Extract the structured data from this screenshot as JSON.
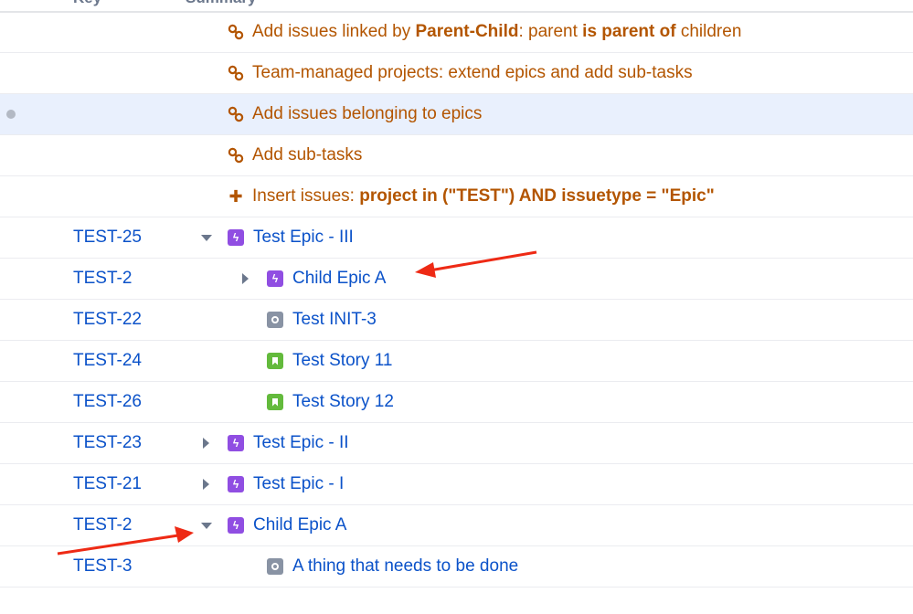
{
  "header": {
    "key": "Key",
    "summary": "Summary"
  },
  "actions": [
    {
      "icon": "link-icon",
      "parts": [
        {
          "t": "Add issues linked by ",
          "b": false
        },
        {
          "t": "Parent-Child",
          "b": true
        },
        {
          "t": ": parent ",
          "b": false
        },
        {
          "t": "is parent of",
          "b": true
        },
        {
          "t": " children",
          "b": false
        }
      ]
    },
    {
      "icon": "link-icon",
      "parts": [
        {
          "t": "Team-managed projects: extend epics and add sub-tasks",
          "b": false
        }
      ]
    },
    {
      "icon": "link-icon",
      "highlighted": true,
      "parts": [
        {
          "t": "Add issues belonging to epics",
          "b": false
        }
      ]
    },
    {
      "icon": "link-icon",
      "parts": [
        {
          "t": "Add sub-tasks",
          "b": false
        }
      ]
    },
    {
      "icon": "plus-icon",
      "parts": [
        {
          "t": "Insert issues: ",
          "b": false
        },
        {
          "t": "project in (\"TEST\") AND issuetype = \"Epic\"",
          "b": true
        }
      ]
    }
  ],
  "issues": [
    {
      "key": "TEST-25",
      "summary": "Test Epic - III",
      "type": "epic",
      "level": 0,
      "toggle": "expanded"
    },
    {
      "key": "TEST-2",
      "summary": "Child Epic A",
      "type": "epic",
      "level": 1,
      "toggle": "collapsed"
    },
    {
      "key": "TEST-22",
      "summary": "Test INIT-3",
      "type": "task",
      "level": 1,
      "toggle": "none"
    },
    {
      "key": "TEST-24",
      "summary": "Test Story 11",
      "type": "story",
      "level": 1,
      "toggle": "none"
    },
    {
      "key": "TEST-26",
      "summary": "Test Story 12",
      "type": "story",
      "level": 1,
      "toggle": "none"
    },
    {
      "key": "TEST-23",
      "summary": "Test Epic - II",
      "type": "epic",
      "level": 0,
      "toggle": "collapsed"
    },
    {
      "key": "TEST-21",
      "summary": "Test Epic - I",
      "type": "epic",
      "level": 0,
      "toggle": "collapsed"
    },
    {
      "key": "TEST-2",
      "summary": "Child Epic A",
      "type": "epic",
      "level": 0,
      "toggle": "expanded"
    },
    {
      "key": "TEST-3",
      "summary": "A thing that needs to be done",
      "type": "task",
      "level": 1,
      "toggle": "none"
    }
  ],
  "colors": {
    "action": "#b35500",
    "link": "#0b52c9",
    "epic": "#904ee2",
    "story": "#63ba3c",
    "task": "#8993a4",
    "annotation_arrow": "#ee2a15"
  }
}
